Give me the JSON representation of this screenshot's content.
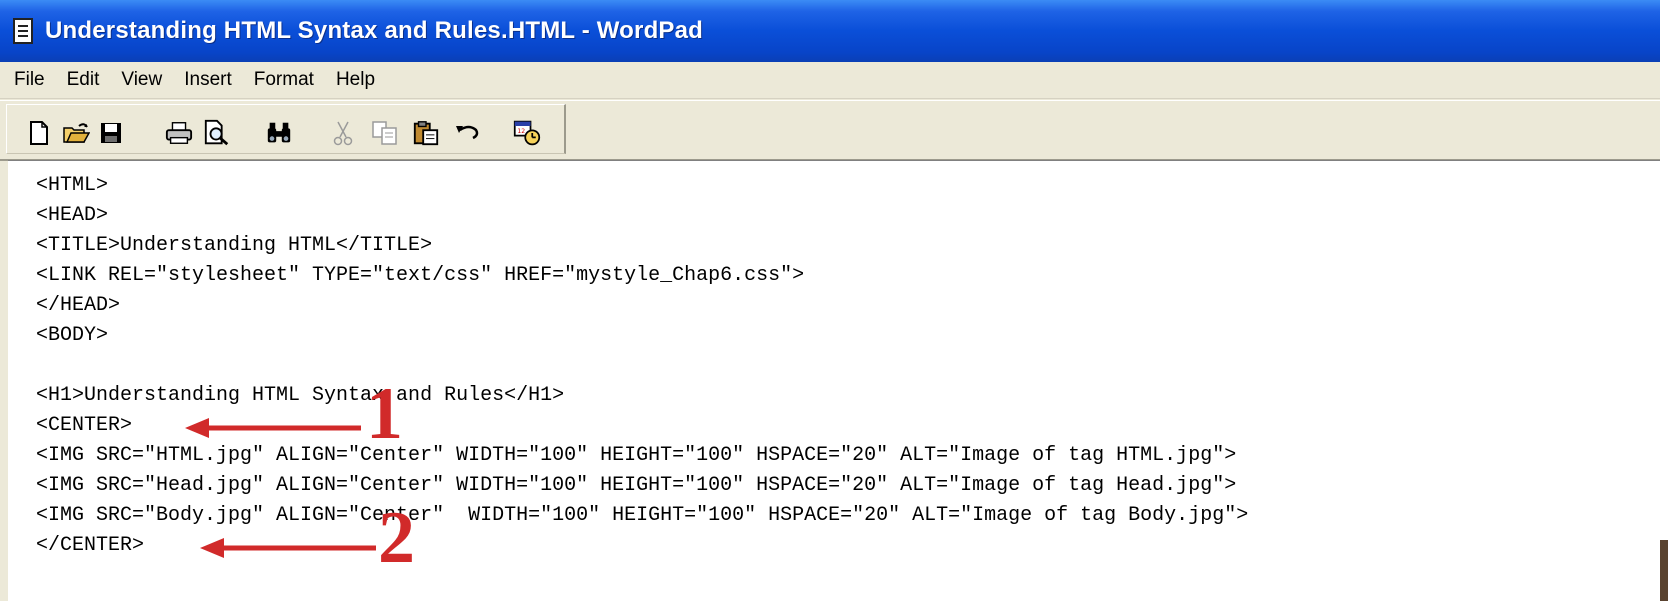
{
  "window": {
    "title": "Understanding HTML Syntax and Rules.HTML - WordPad",
    "icon": "wordpad-document-icon"
  },
  "menubar": {
    "items": [
      {
        "label": "File",
        "accel": "F"
      },
      {
        "label": "Edit",
        "accel": "E"
      },
      {
        "label": "View",
        "accel": "V"
      },
      {
        "label": "Insert",
        "accel": "I"
      },
      {
        "label": "Format",
        "accel": "o"
      },
      {
        "label": "Help",
        "accel": "H"
      }
    ]
  },
  "toolbar": {
    "buttons": [
      {
        "icon": "new-document-icon",
        "enabled": true
      },
      {
        "icon": "open-folder-icon",
        "enabled": true
      },
      {
        "icon": "save-icon",
        "enabled": true
      },
      {
        "icon": "print-icon",
        "enabled": true
      },
      {
        "icon": "print-preview-icon",
        "enabled": true
      },
      {
        "icon": "find-binoculars-icon",
        "enabled": true
      },
      {
        "icon": "cut-icon",
        "enabled": false
      },
      {
        "icon": "copy-icon",
        "enabled": false
      },
      {
        "icon": "paste-icon",
        "enabled": true
      },
      {
        "icon": "undo-icon",
        "enabled": true
      },
      {
        "icon": "date-time-icon",
        "enabled": true
      }
    ]
  },
  "document": {
    "lines": [
      "<HTML>",
      "<HEAD>",
      "<TITLE>Understanding HTML</TITLE>",
      "<LINK REL=\"stylesheet\" TYPE=\"text/css\" HREF=\"mystyle_Chap6.css\">",
      "</HEAD>",
      "<BODY>",
      "",
      "<H1>Understanding HTML Syntax and Rules</H1>",
      "<CENTER>",
      "<IMG SRC=\"HTML.jpg\" ALIGN=\"Center\" WIDTH=\"100\" HEIGHT=\"100\" HSPACE=\"20\" ALT=\"Image of tag HTML.jpg\">",
      "<IMG SRC=\"Head.jpg\" ALIGN=\"Center\" WIDTH=\"100\" HEIGHT=\"100\" HSPACE=\"20\" ALT=\"Image of tag Head.jpg\">",
      "<IMG SRC=\"Body.jpg\" ALIGN=\"Center\"  WIDTH=\"100\" HEIGHT=\"100\" HSPACE=\"20\" ALT=\"Image of tag Body.jpg\">",
      "</CENTER>"
    ]
  },
  "annotations": [
    {
      "number": "1",
      "points_to": "<CENTER>",
      "color": "#d12a2a"
    },
    {
      "number": "2",
      "points_to": "</CENTER>",
      "color": "#d12a2a"
    }
  ],
  "colors": {
    "titlebar": "#0a4fd8",
    "chrome": "#ece9d8",
    "annotation": "#d12a2a"
  }
}
